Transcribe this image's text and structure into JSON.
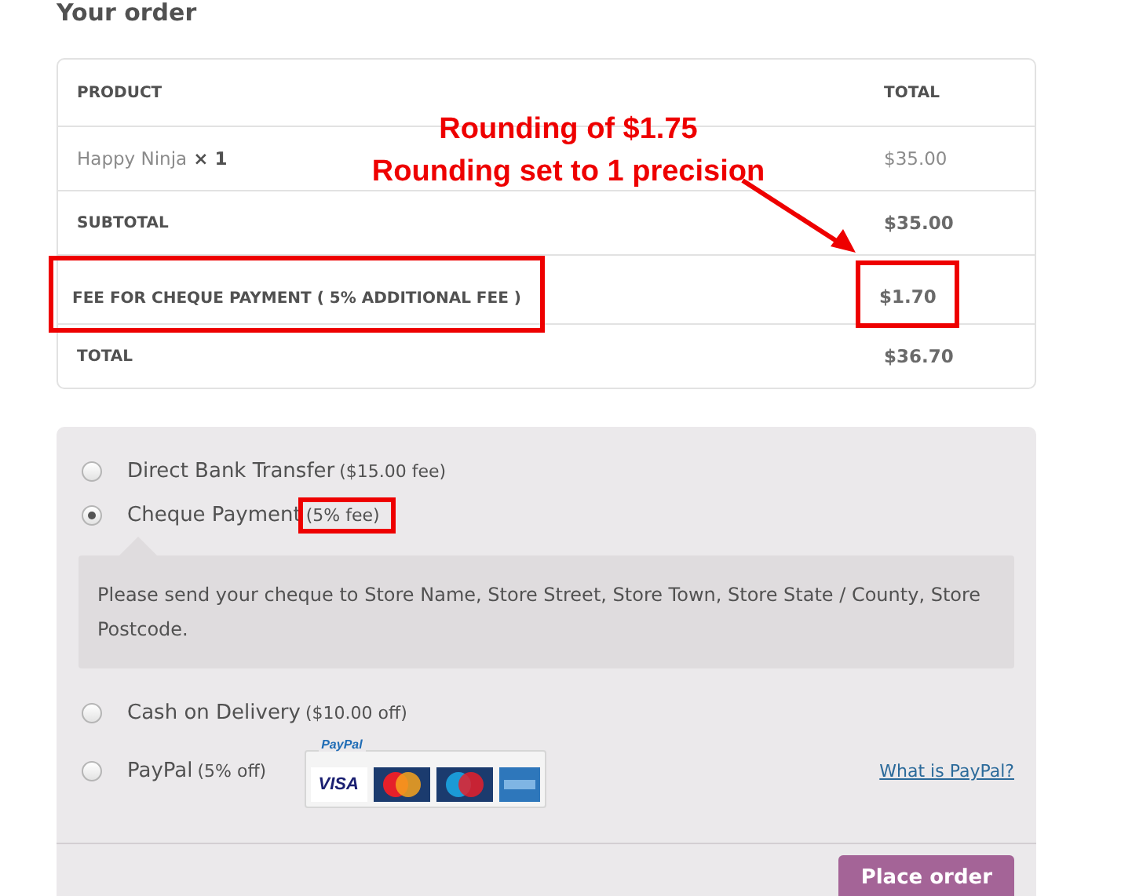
{
  "heading": "Your order",
  "order_table": {
    "columns": [
      "PRODUCT",
      "TOTAL"
    ],
    "rows": [
      {
        "kind": "item",
        "label": "Happy Ninja",
        "quantity": "× 1",
        "value": "$35.00",
        "highlighted": false
      },
      {
        "kind": "summary",
        "label": "SUBTOTAL",
        "value": "$35.00",
        "highlighted": false
      },
      {
        "kind": "summary",
        "label": "FEE FOR CHEQUE PAYMENT ( 5% ADDITIONAL FEE )",
        "value": "$1.70",
        "highlighted": true
      },
      {
        "kind": "summary",
        "label": "TOTAL",
        "value": "$36.70",
        "highlighted": false
      }
    ]
  },
  "annotation": {
    "lines": [
      "Rounding of $1.75",
      "Rounding set to 1 precision"
    ]
  },
  "payment_methods": [
    {
      "label": "Direct Bank Transfer",
      "note": "($15.00 fee)",
      "selected": false,
      "highlighted": false
    },
    {
      "label": "Cheque Payment",
      "note": "(5% fee)",
      "selected": true,
      "highlighted": true,
      "description": "Please send your cheque to Store Name, Store Street, Store Town, Store State / County, Store Postcode."
    },
    {
      "label": "Cash on Delivery",
      "note": "($10.00 off)",
      "selected": false,
      "highlighted": false
    },
    {
      "label": "PayPal",
      "note": "(5% off)",
      "selected": false,
      "highlighted": false,
      "logo_label": "PayPal",
      "card_text": "VISA",
      "link": "What is PayPal?"
    }
  ],
  "place_order_button": "Place order"
}
